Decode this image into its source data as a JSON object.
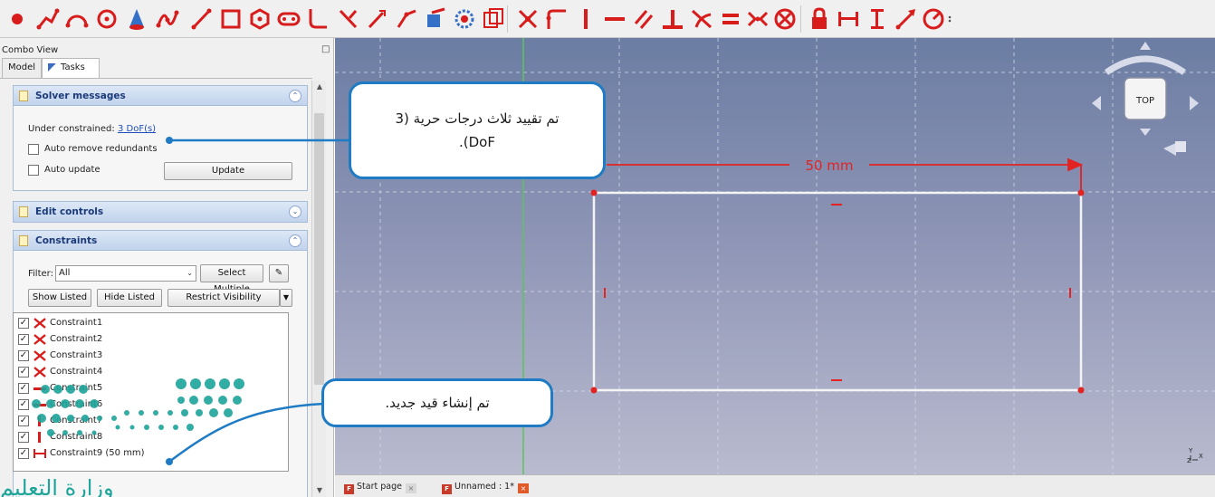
{
  "colors": {
    "constraint_red": "#d81c1c",
    "callout_border": "#1e7bc4",
    "link_blue": "#1f4fb8",
    "logo_teal": "#1ea59b"
  },
  "toolbar": {
    "icons": [
      "point-icon",
      "polyline-icon",
      "arc-icon",
      "circle-icon",
      "conic-icon",
      "bspline-icon",
      "line-icon",
      "rectangle-icon",
      "polygon-icon",
      "slot-icon",
      "fillet-icon",
      "trim-icon",
      "extend-icon",
      "external-geometry-icon",
      "carbon-copy-icon",
      "construction-mode-icon",
      "coincident-constraint-icon",
      "point-on-object-constraint-icon",
      "vertical-constraint-icon",
      "horizontal-constraint-icon",
      "parallel-constraint-icon",
      "perpendicular-constraint-icon",
      "tangent-constraint-icon",
      "equal-constraint-icon",
      "symmetric-constraint-icon",
      "block-constraint-icon",
      "lock-constraint-icon",
      "horizontal-distance-constraint-icon",
      "vertical-distance-constraint-icon",
      "distance-constraint-icon",
      "radius-constraint-icon"
    ]
  },
  "panel": {
    "title": "Combo View",
    "float_icon": "float-icon",
    "tabs": [
      {
        "label": "Model"
      },
      {
        "label": "Tasks"
      }
    ],
    "solver": {
      "title": "Solver messages",
      "under_label": "Under constrained:",
      "dof_link": "3 DoF(s)",
      "auto_remove": "Auto remove redundants",
      "auto_update": "Auto update",
      "update_button": "Update"
    },
    "edit_controls": {
      "title": "Edit controls"
    },
    "constraints": {
      "title": "Constraints",
      "filter_label": "Filter:",
      "filter_value": "All",
      "select_multiple": "Select Multiple",
      "show_listed": "Show Listed",
      "hide_listed": "Hide Listed",
      "restrict_visibility": "Restrict Visibility",
      "items": [
        {
          "label": "Constraint1",
          "icon": "coincident"
        },
        {
          "label": "Constraint2",
          "icon": "coincident"
        },
        {
          "label": "Constraint3",
          "icon": "coincident"
        },
        {
          "label": "Constraint4",
          "icon": "coincident"
        },
        {
          "label": "Constraint5",
          "icon": "horizontal"
        },
        {
          "label": "Constraint6",
          "icon": "horizontal"
        },
        {
          "label": "Constraint7",
          "icon": "vertical"
        },
        {
          "label": "Constraint8",
          "icon": "vertical"
        },
        {
          "label": "Constraint9 (50 mm)",
          "icon": "horizontal-distance"
        }
      ]
    }
  },
  "viewport": {
    "dimension_label": "50 mm",
    "navcube_face": "TOP",
    "axis_y": "Y",
    "axis_z": "Z",
    "axis_x": "X"
  },
  "doc_tabs": [
    {
      "label": "Start page"
    },
    {
      "label": "Unnamed : 1*"
    }
  ],
  "callouts": {
    "dof": "تم تقييد ثلاث درجات حرية (3 DoF).",
    "new_constraint": "تم إنشاء قيد جديد."
  },
  "logo": {
    "text": "وزارة التعليم"
  }
}
